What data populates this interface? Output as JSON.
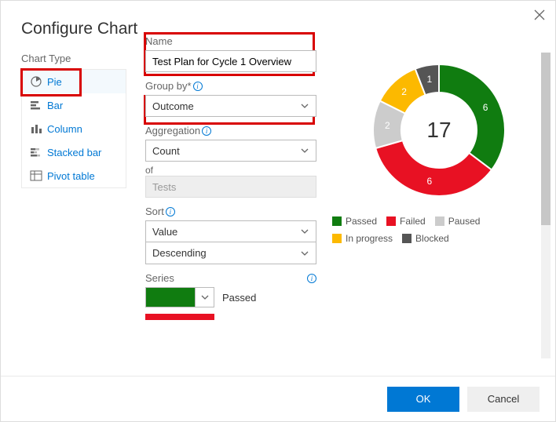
{
  "dialog": {
    "title": "Configure Chart",
    "close_label": "Close"
  },
  "chart_type": {
    "section_label": "Chart Type",
    "selected": "Pie",
    "items": [
      {
        "name": "pie",
        "label": "Pie"
      },
      {
        "name": "bar",
        "label": "Bar"
      },
      {
        "name": "column",
        "label": "Column"
      },
      {
        "name": "stacked-bar",
        "label": "Stacked bar"
      },
      {
        "name": "pivot-table",
        "label": "Pivot table"
      }
    ]
  },
  "form": {
    "name_label": "Name",
    "name_value": "Test Plan for Cycle 1 Overview",
    "groupby_label": "Group by*",
    "groupby_value": "Outcome",
    "aggregation_label": "Aggregation",
    "aggregation_value": "Count",
    "of_label": "of",
    "of_value": "Tests",
    "sort_label": "Sort",
    "sort_value": "Value",
    "sort_dir": "Descending",
    "series_label": "Series",
    "series_item_label": "Passed",
    "series_color": "#107c10",
    "series_strip_color": "#e81123"
  },
  "chart_data": {
    "type": "pie",
    "subtype": "donut",
    "title": "",
    "total": 17,
    "categories": [
      "Passed",
      "Failed",
      "Paused",
      "In progress",
      "Blocked"
    ],
    "values": [
      6,
      6,
      2,
      2,
      1
    ],
    "colors": {
      "Passed": "#107c10",
      "Failed": "#e81123",
      "Paused": "#cccccc",
      "In progress": "#fcb900",
      "Blocked": "#555555"
    },
    "legend": [
      "Passed",
      "Failed",
      "Paused",
      "In progress",
      "Blocked"
    ]
  },
  "footer": {
    "ok": "OK",
    "cancel": "Cancel"
  }
}
